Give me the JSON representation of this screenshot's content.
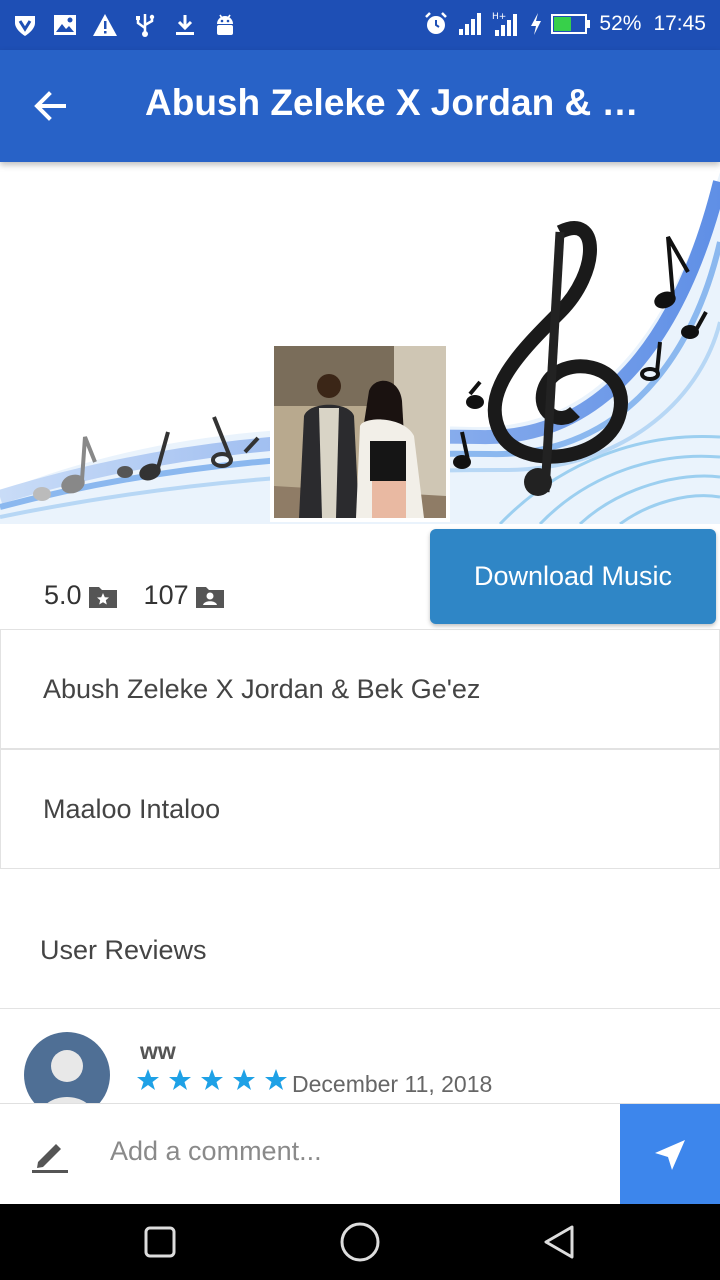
{
  "status_bar": {
    "battery": "52%",
    "time": "17:45",
    "left_icons": [
      "shield-icon",
      "image-icon",
      "warning-icon",
      "usb-icon",
      "download-icon",
      "android-icon"
    ],
    "right_icons": [
      "alarm-icon",
      "signal-icon",
      "signal-h-plus-icon",
      "charging-icon",
      "battery-icon"
    ]
  },
  "app_bar": {
    "title": "Abush Zeleke X Jordan & Bek Ge'ez",
    "back_icon": "arrow-back-icon",
    "color": "#2862c7"
  },
  "stats": {
    "rating": "5.0",
    "rating_icon": "folder-star-icon",
    "count": "107",
    "count_icon": "folder-user-icon"
  },
  "download_button": {
    "label": "Download Music",
    "color": "#2f86c6"
  },
  "details": {
    "artist": "Abush Zeleke X Jordan & Bek Ge'ez",
    "song": "Maaloo Intaloo"
  },
  "reviews": {
    "title": "User Reviews",
    "items": [
      {
        "user": "ww",
        "stars": 5,
        "date": "December 11, 2018"
      }
    ],
    "star_color": "#1ea1e6"
  },
  "comment": {
    "placeholder": "Add a comment...",
    "pencil_icon": "pencil-icon",
    "send_icon": "send-icon",
    "send_color": "#3d86ec"
  },
  "nav": [
    "recents-square-icon",
    "home-circle-icon",
    "back-triangle-icon"
  ]
}
